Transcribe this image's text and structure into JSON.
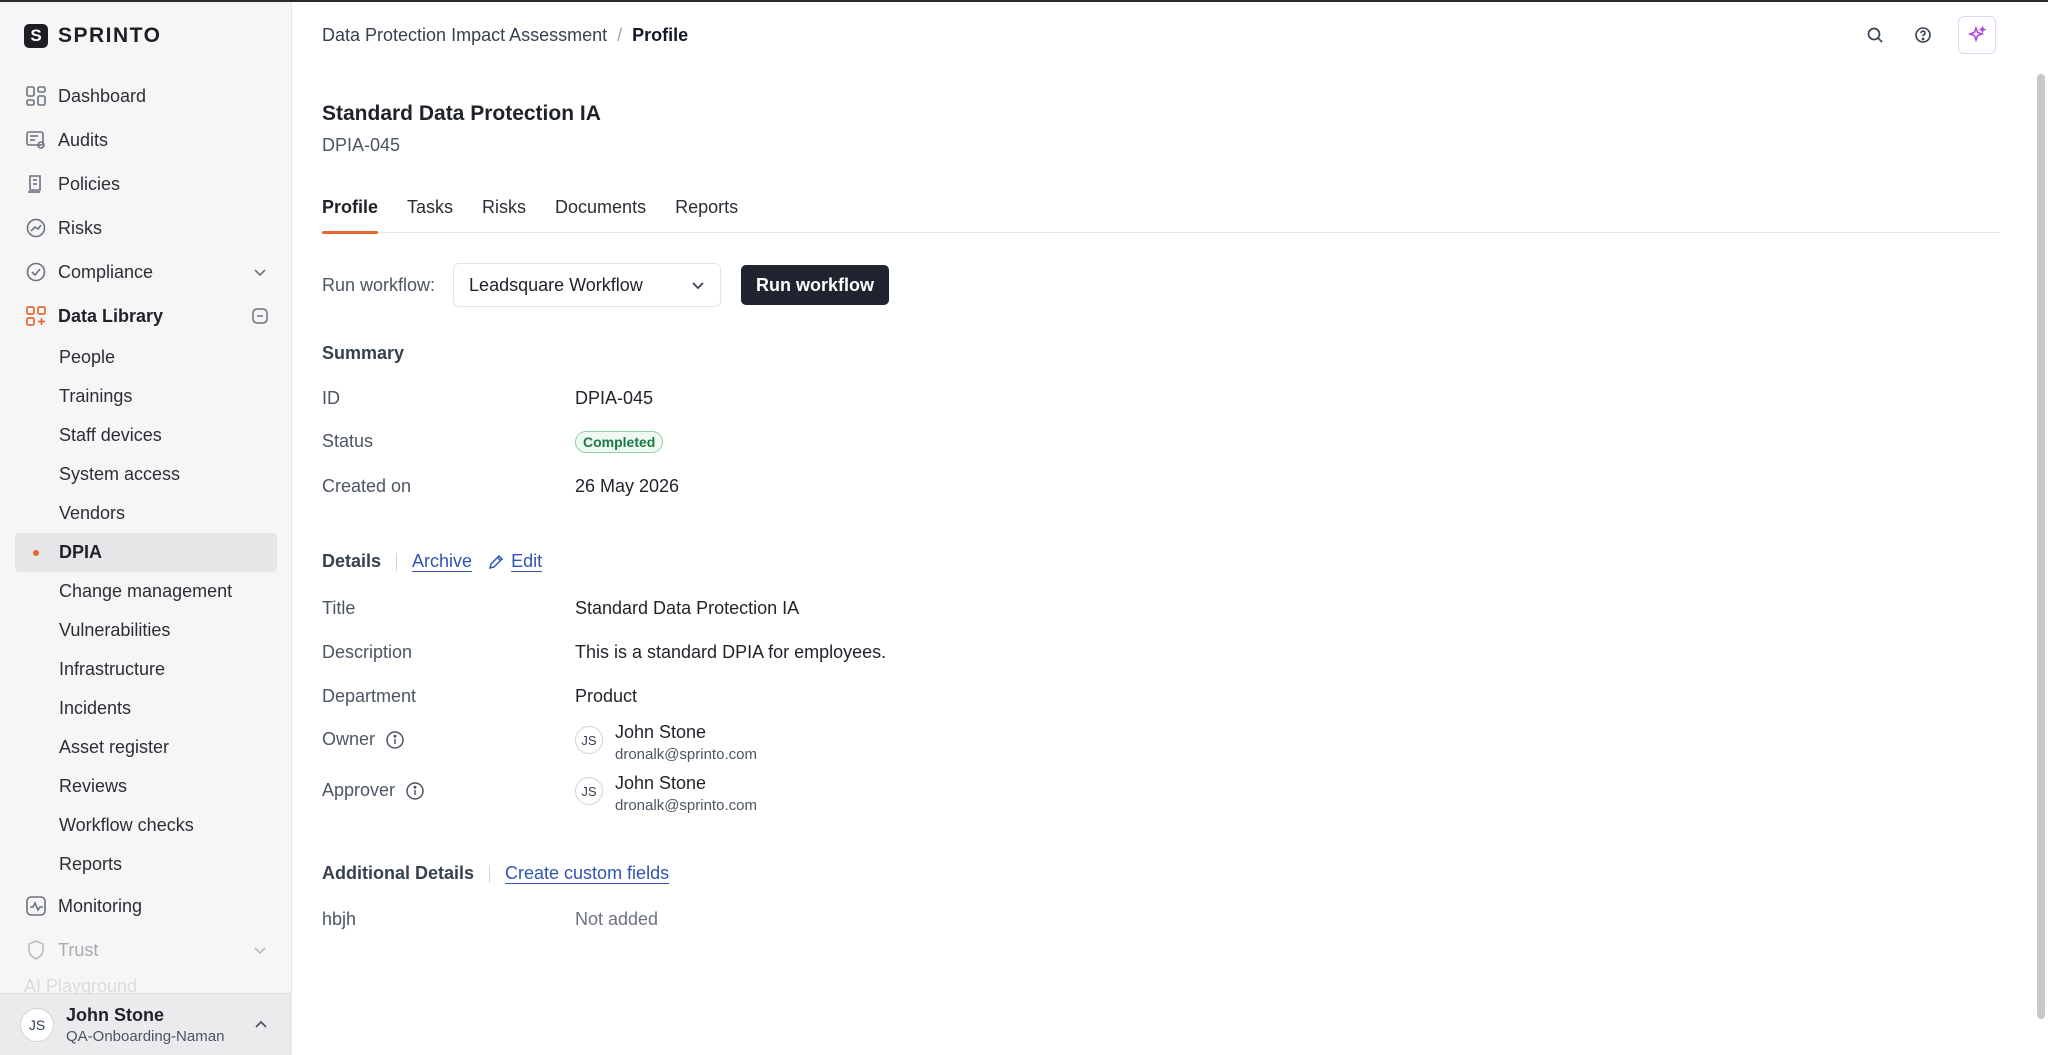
{
  "app": {
    "logo_text": "SPRINTO",
    "logo_mark": "S"
  },
  "sidebar": {
    "items": [
      {
        "label": "Dashboard",
        "icon": "dashboard-icon"
      },
      {
        "label": "Audits",
        "icon": "audits-icon"
      },
      {
        "label": "Policies",
        "icon": "policies-icon"
      },
      {
        "label": "Risks",
        "icon": "risks-icon"
      },
      {
        "label": "Compliance",
        "icon": "compliance-icon"
      },
      {
        "label": "Data Library",
        "icon": "data-library-icon"
      }
    ],
    "sub_items": [
      "People",
      "Trainings",
      "Staff devices",
      "System access",
      "Vendors",
      "DPIA",
      "Change management",
      "Vulnerabilities",
      "Infrastructure",
      "Incidents",
      "Asset register",
      "Reviews",
      "Workflow checks",
      "Reports"
    ],
    "selected_sub_item": "DPIA",
    "after_items": [
      {
        "label": "Monitoring",
        "icon": "monitoring-icon"
      },
      {
        "label": "Trust",
        "icon": "trust-icon"
      }
    ],
    "faded_item": "AI Playground",
    "user": {
      "initials": "JS",
      "name": "John Stone",
      "org": "QA-Onboarding-Naman"
    }
  },
  "breadcrumb": {
    "parent": "Data Protection Impact Assessment",
    "separator": "/",
    "current": "Profile"
  },
  "page": {
    "title": "Standard Data Protection IA",
    "subtitle": "DPIA-045"
  },
  "tabs": [
    "Profile",
    "Tasks",
    "Risks",
    "Documents",
    "Reports"
  ],
  "active_tab": "Profile",
  "workflow": {
    "label": "Run workflow:",
    "selected": "Leadsquare Workflow",
    "button": "Run workflow"
  },
  "summary": {
    "heading": "Summary",
    "id_label": "ID",
    "id_value": "DPIA-045",
    "status_label": "Status",
    "status_value": "Completed",
    "created_label": "Created on",
    "created_value": "26 May 2026"
  },
  "details": {
    "heading": "Details",
    "archive_label": "Archive",
    "edit_label": "Edit",
    "title_label": "Title",
    "title_value": "Standard Data Protection IA",
    "description_label": "Description",
    "description_value": "This is a standard DPIA for employees.",
    "department_label": "Department",
    "department_value": "Product",
    "owner_label": "Owner",
    "owner": {
      "initials": "JS",
      "name": "John Stone",
      "email": "dronalk@sprinto.com"
    },
    "approver_label": "Approver",
    "approver": {
      "initials": "JS",
      "name": "John Stone",
      "email": "dronalk@sprinto.com"
    }
  },
  "additional": {
    "heading": "Additional Details",
    "create_link": "Create custom fields",
    "field_label": "hbjh",
    "field_value": "Not added"
  },
  "colors": {
    "accent": "#e8672f",
    "link": "#2f55b3",
    "primary_button": "#1f2430",
    "success": "#1d7a44"
  }
}
